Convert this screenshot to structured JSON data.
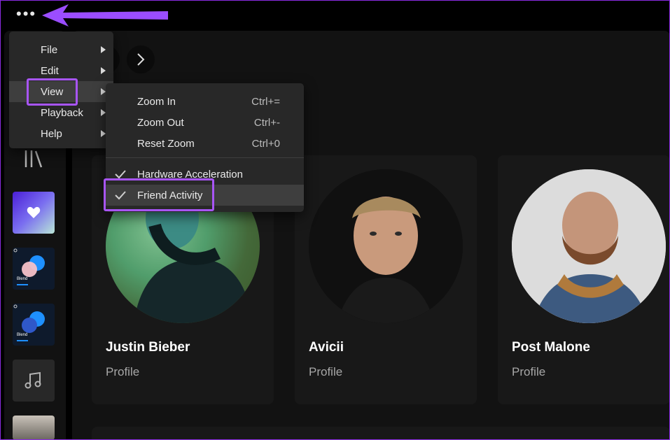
{
  "topbar": {
    "dots_icon": "more-horizontal-icon",
    "accent": "#a855f7"
  },
  "menu": {
    "items": [
      {
        "label": "File"
      },
      {
        "label": "Edit"
      },
      {
        "label": "View"
      },
      {
        "label": "Playback"
      },
      {
        "label": "Help"
      }
    ],
    "active": "View"
  },
  "submenu": {
    "items": [
      {
        "label": "Zoom In",
        "shortcut": "Ctrl+=",
        "checked": false
      },
      {
        "label": "Zoom Out",
        "shortcut": "Ctrl+-",
        "checked": false
      },
      {
        "label": "Reset Zoom",
        "shortcut": "Ctrl+0",
        "checked": false
      },
      {
        "label": "Hardware Acceleration",
        "shortcut": "",
        "checked": true
      },
      {
        "label": "Friend Activity",
        "shortcut": "",
        "checked": true
      }
    ],
    "highlighted": "Friend Activity"
  },
  "sidebar": {
    "blend_label": "Blend"
  },
  "cards": [
    {
      "name": "Justin Bieber",
      "subtitle": "Profile"
    },
    {
      "name": "Avicii",
      "subtitle": "Profile"
    },
    {
      "name": "Post Malone",
      "subtitle": "Profile"
    }
  ]
}
